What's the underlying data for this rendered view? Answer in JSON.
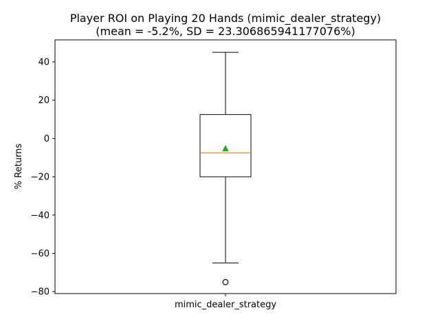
{
  "chart_data": {
    "type": "box",
    "title": [
      "Player ROI on Playing 20 Hands (mimic_dealer_strategy)",
      "(mean = -5.2%, SD = 23.306865941177076%)"
    ],
    "xlabel": "",
    "ylabel": "% Returns",
    "categories": [
      "mimic_dealer_strategy"
    ],
    "ylim": [
      -81,
      51.5
    ],
    "yticks": [
      40,
      20,
      0,
      -20,
      -40,
      -60,
      -80
    ],
    "ytick_labels": [
      "40",
      "20",
      "0",
      "−20",
      "−40",
      "−60",
      "−80"
    ],
    "grid": false,
    "boxes": [
      {
        "name": "mimic_dealer_strategy",
        "whisker_high": 45,
        "q3": 12.5,
        "median": -7.5,
        "mean": -5.2,
        "q1": -20,
        "whisker_low": -65,
        "outliers": [
          -75
        ]
      }
    ],
    "colors": {
      "box": "#000000",
      "median": "#ff7f0e",
      "mean": "#2ca02c",
      "flier": "#000000"
    }
  }
}
